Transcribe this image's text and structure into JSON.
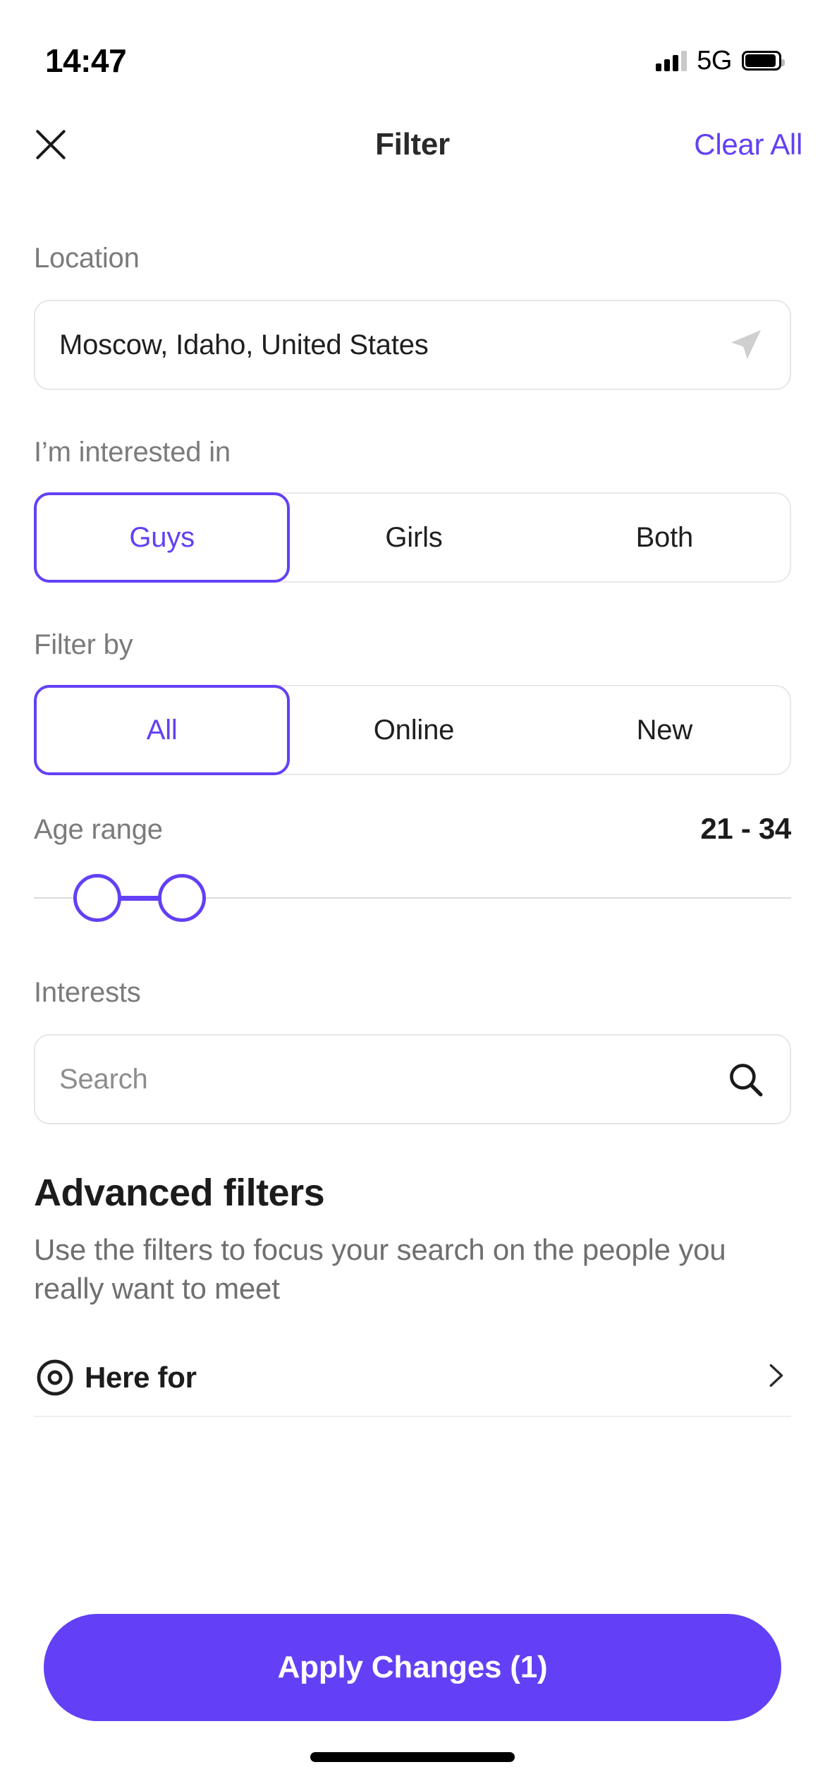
{
  "status_bar": {
    "time": "14:47",
    "network": "5G",
    "signal_icon": "signal-bars-icon",
    "battery_icon": "battery-icon"
  },
  "header": {
    "title": "Filter",
    "close_icon": "close-icon",
    "clear_all_label": "Clear All"
  },
  "location": {
    "label": "Location",
    "value": "Moscow, Idaho, United States",
    "locate_icon": "navigation-arrow-icon"
  },
  "interested_in": {
    "label": "I’m interested in",
    "options": [
      {
        "label": "Guys",
        "selected": true
      },
      {
        "label": "Girls",
        "selected": false
      },
      {
        "label": "Both",
        "selected": false
      }
    ]
  },
  "filter_by": {
    "label": "Filter by",
    "options": [
      {
        "label": "All",
        "selected": true
      },
      {
        "label": "Online",
        "selected": false
      },
      {
        "label": "New",
        "selected": false
      }
    ]
  },
  "age_range": {
    "label": "Age range",
    "value": "21 - 34",
    "min": 21,
    "max": 34
  },
  "interests": {
    "label": "Interests",
    "placeholder": "Search",
    "search_icon": "search-icon"
  },
  "advanced": {
    "title": "Advanced filters",
    "description": "Use the filters to focus your search on the people you really want to meet",
    "rows": [
      {
        "label": "Here for",
        "icon": "target-circle-icon",
        "chevron": "chevron-right-icon"
      }
    ]
  },
  "cta": {
    "label": "Apply Changes (1)"
  },
  "colors": {
    "accent": "#6340f5",
    "text_primary": "#1c1c1c",
    "text_secondary": "#7b7b7b",
    "border": "#e6e6e6",
    "background": "#ffffff"
  }
}
